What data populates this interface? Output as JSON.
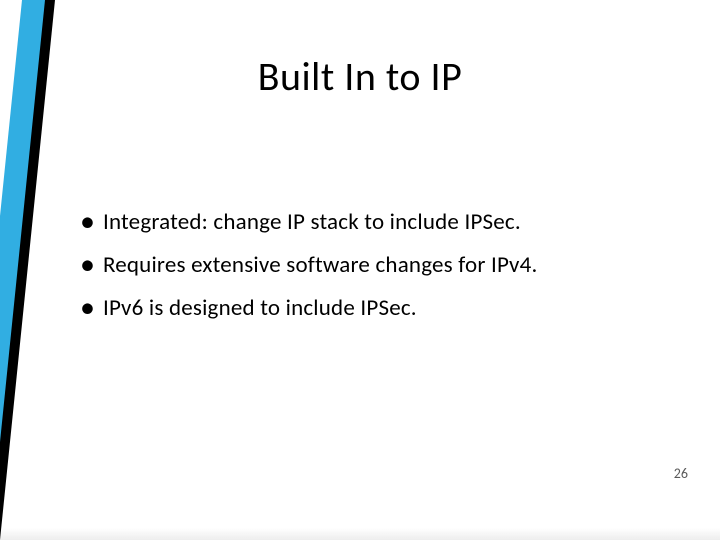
{
  "slide": {
    "title": "Built In to IP",
    "bullets": [
      "Integrated:  change IP stack to include IPSec.",
      "Requires extensive software changes for IPv4.",
      "IPv6 is designed to include IPSec."
    ],
    "page_number": "26"
  },
  "colors": {
    "triangle_outer": "#000000",
    "triangle_mid": "#31aee2",
    "triangle_inner": "#ffffff"
  }
}
